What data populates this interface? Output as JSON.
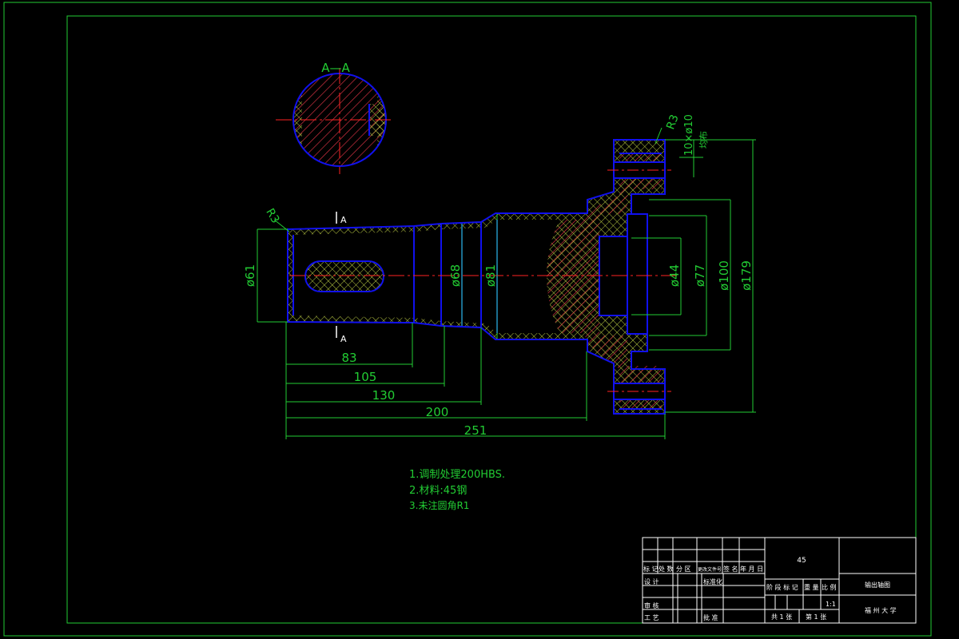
{
  "section": {
    "title": "A—A",
    "marker_top": "A",
    "marker_bottom": "A"
  },
  "dims": {
    "r_left": "R3",
    "r_flange": "R3",
    "holes": "10×ø10",
    "holes_note": "均布",
    "d61": "ø61",
    "d68": "ø68",
    "d81": "ø81",
    "d44": "ø44",
    "d77": "ø77",
    "d100": "ø100",
    "d179": "ø179",
    "l83": "83",
    "l105": "105",
    "l130": "130",
    "l200": "200",
    "l251": "251"
  },
  "notes": [
    "1.调制处理200HBS.",
    "2.材料:45钢",
    "3.未注圆角R1"
  ],
  "title_block": {
    "material": "45",
    "drawing_name": "输出轴图",
    "scale": "1:1",
    "sheets_total": "共 1 张",
    "sheet_no": "第 1 张",
    "school": "福 州 大 学",
    "header_labels": [
      "标 记",
      "处 数",
      "分 区",
      "更改文件号",
      "签 名",
      "年 月 日"
    ],
    "row_design": "设 计",
    "row_standard": "标准化",
    "row_review": "审 核",
    "row_process": "工 艺",
    "row_approve": "批 准",
    "stage_labels": [
      "阶 段 标 记",
      "重 量",
      "比 例"
    ]
  },
  "colors": {
    "frame": "#22cc33",
    "outline": "#1111ee",
    "hatch": "#dd3344",
    "crosshatch": "#bbcc44",
    "center": "#ff2222",
    "text": "#ffffff"
  }
}
